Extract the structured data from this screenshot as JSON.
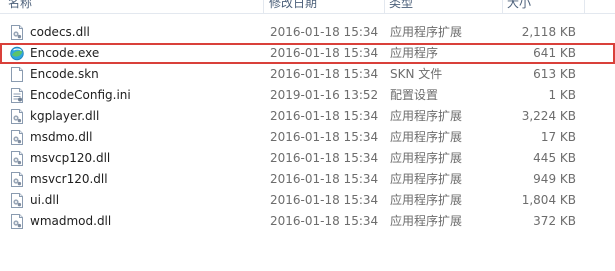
{
  "header": {
    "name": "名称",
    "date": "修改日期",
    "type": "类型",
    "size": "大小"
  },
  "files": [
    {
      "name": "codecs.dll",
      "date": "2016-01-18 15:34",
      "type": "应用程序扩展",
      "size": "2,118 KB",
      "icon": "dll-file-icon"
    },
    {
      "name": "Encode.exe",
      "date": "2016-01-18 15:34",
      "type": "应用程序",
      "size": "641 KB",
      "icon": "app-globe-icon",
      "highlighted": true
    },
    {
      "name": "Encode.skn",
      "date": "2016-01-18 15:34",
      "type": "SKN 文件",
      "size": "613 KB",
      "icon": "blank-file-icon"
    },
    {
      "name": "EncodeConfig.ini",
      "date": "2019-01-16 13:52",
      "type": "配置设置",
      "size": "1 KB",
      "icon": "ini-file-icon"
    },
    {
      "name": "kgplayer.dll",
      "date": "2016-01-18 15:34",
      "type": "应用程序扩展",
      "size": "3,224 KB",
      "icon": "dll-file-icon"
    },
    {
      "name": "msdmo.dll",
      "date": "2016-01-18 15:34",
      "type": "应用程序扩展",
      "size": "17 KB",
      "icon": "dll-file-icon"
    },
    {
      "name": "msvcp120.dll",
      "date": "2016-01-18 15:34",
      "type": "应用程序扩展",
      "size": "445 KB",
      "icon": "dll-file-icon"
    },
    {
      "name": "msvcr120.dll",
      "date": "2016-01-18 15:34",
      "type": "应用程序扩展",
      "size": "949 KB",
      "icon": "dll-file-icon"
    },
    {
      "name": "ui.dll",
      "date": "2016-01-18 15:34",
      "type": "应用程序扩展",
      "size": "1,804 KB",
      "icon": "dll-file-icon"
    },
    {
      "name": "wmadmod.dll",
      "date": "2016-01-18 15:34",
      "type": "应用程序扩展",
      "size": "372 KB",
      "icon": "dll-file-icon"
    }
  ],
  "colors": {
    "highlight_border": "#d9403a",
    "header_text": "#4c607a",
    "secondary_text": "#6d6d6d"
  }
}
